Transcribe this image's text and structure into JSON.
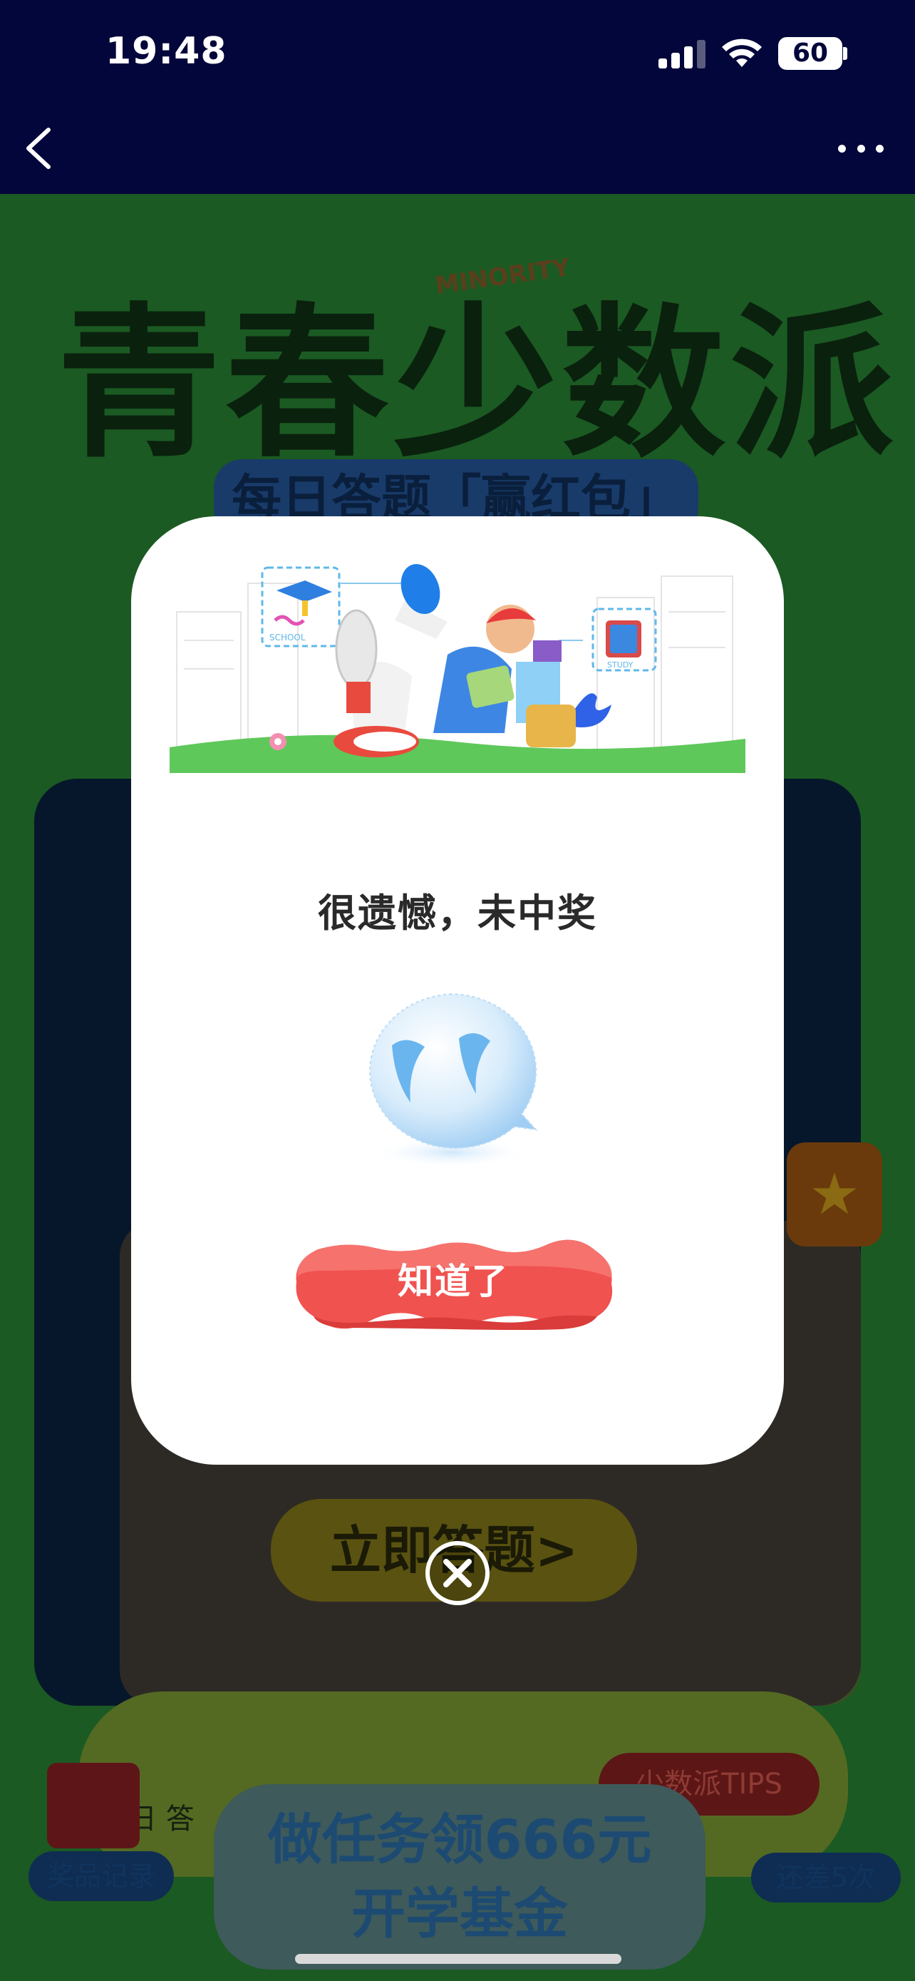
{
  "status_bar": {
    "time": "19:48",
    "battery": "60"
  },
  "background": {
    "title": "青春少数派",
    "minority": "MINORITY",
    "subtitle": "每日答题「赢红包」",
    "answer_button": "立即答题>",
    "daily_label": "每日 答",
    "tips_label": "少数派TIPS",
    "task_text_line1": "做任务领666元",
    "task_text_line2": "开学基金",
    "prize_record_label": "奖品记录",
    "remaining_label": "还差5次",
    "star_tab": "★"
  },
  "modal": {
    "title": "很遗憾，未中奖",
    "confirm_button": "知道了",
    "banner_tags": {
      "school": "SCHOOL",
      "study": "STUDY"
    }
  },
  "colors": {
    "nav_bg": "#03063a",
    "button_red": "#f0524f",
    "modal_bg": "#ffffff"
  }
}
